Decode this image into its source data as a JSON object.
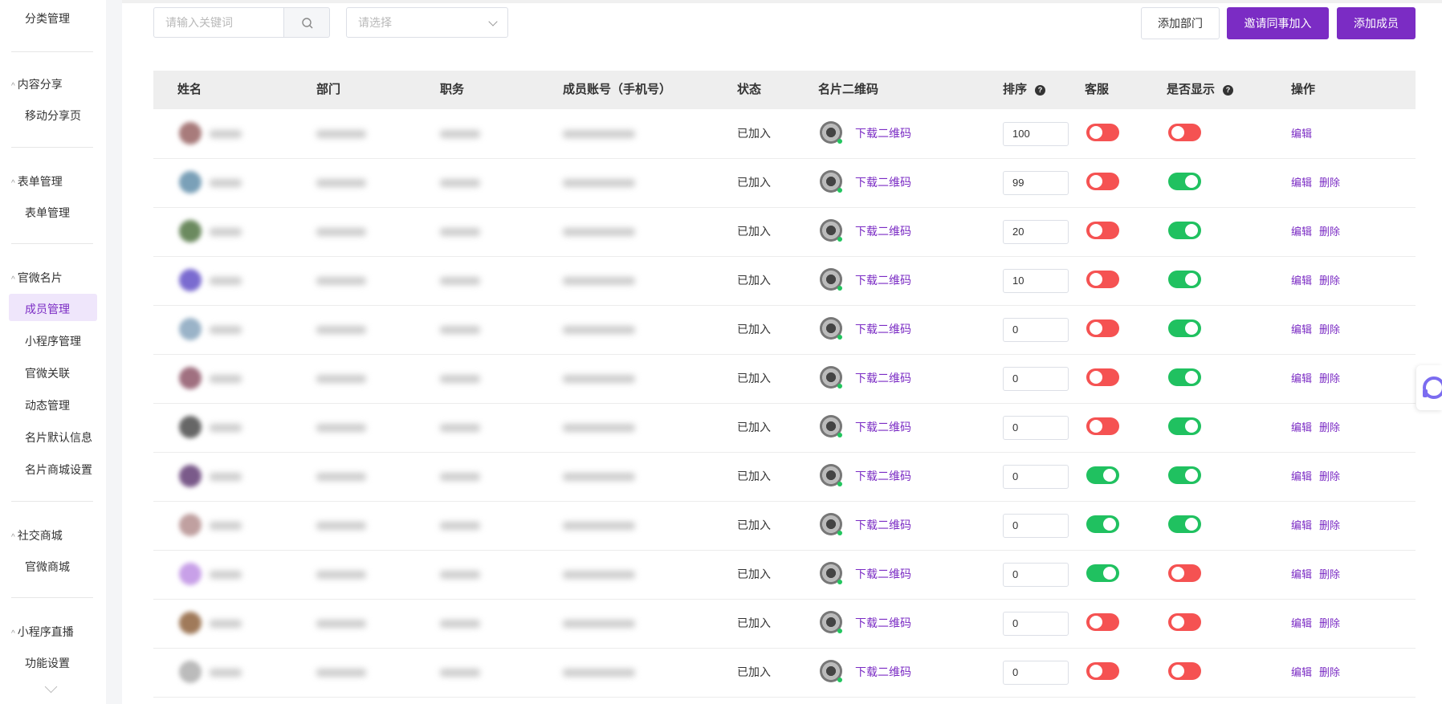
{
  "sidebar": {
    "groups": [
      {
        "label": "分类管理",
        "items": []
      },
      {
        "label": "内容分享",
        "items": [
          "移动分享页"
        ]
      },
      {
        "label": "表单管理",
        "items": [
          "表单管理"
        ]
      },
      {
        "label": "官微名片",
        "items": [
          "成员管理",
          "小程序管理",
          "官微关联",
          "动态管理",
          "名片默认信息",
          "名片商城设置"
        ]
      },
      {
        "label": "社交商城",
        "items": [
          "官微商城"
        ]
      },
      {
        "label": "小程序直播",
        "items": [
          "功能设置"
        ]
      }
    ],
    "active_item": "成员管理"
  },
  "toolbar": {
    "search_placeholder": "请输入关键词",
    "select_placeholder": "请选择",
    "add_department": "添加部门",
    "invite_colleague": "邀请同事加入",
    "add_member": "添加成员"
  },
  "table": {
    "headers": {
      "name": "姓名",
      "department": "部门",
      "position": "职务",
      "account": "成员账号（手机号）",
      "status": "状态",
      "qrcode": "名片二维码",
      "sort": "排序",
      "customer_service": "客服",
      "show": "是否显示",
      "actions": "操作"
    },
    "download_label": "下载二维码",
    "edit_label": "编辑",
    "delete_label": "删除",
    "rows": [
      {
        "status": "已加入",
        "sort": "100",
        "customer_service": false,
        "show": false,
        "deletable": false
      },
      {
        "status": "已加入",
        "sort": "99",
        "customer_service": false,
        "show": true,
        "deletable": true
      },
      {
        "status": "已加入",
        "sort": "20",
        "customer_service": false,
        "show": true,
        "deletable": true
      },
      {
        "status": "已加入",
        "sort": "10",
        "customer_service": false,
        "show": true,
        "deletable": true
      },
      {
        "status": "已加入",
        "sort": "0",
        "customer_service": false,
        "show": true,
        "deletable": true
      },
      {
        "status": "已加入",
        "sort": "0",
        "customer_service": false,
        "show": true,
        "deletable": true
      },
      {
        "status": "已加入",
        "sort": "0",
        "customer_service": false,
        "show": true,
        "deletable": true
      },
      {
        "status": "已加入",
        "sort": "0",
        "customer_service": true,
        "show": true,
        "deletable": true
      },
      {
        "status": "已加入",
        "sort": "0",
        "customer_service": true,
        "show": true,
        "deletable": true
      },
      {
        "status": "已加入",
        "sort": "0",
        "customer_service": true,
        "show": false,
        "deletable": true
      },
      {
        "status": "已加入",
        "sort": "0",
        "customer_service": false,
        "show": false,
        "deletable": true
      },
      {
        "status": "已加入",
        "sort": "0",
        "customer_service": false,
        "show": false,
        "deletable": true
      }
    ]
  },
  "colors": {
    "accent": "#7b2cc4",
    "toggle_on": "#20c160",
    "toggle_off": "#f55252"
  }
}
